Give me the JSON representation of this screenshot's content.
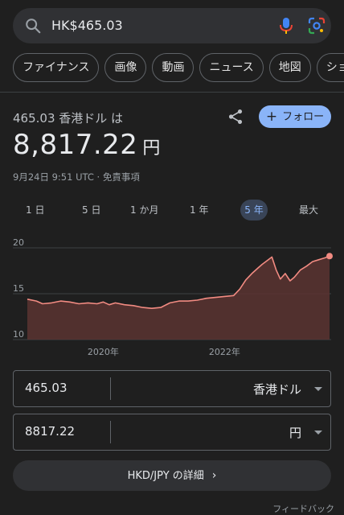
{
  "search": {
    "query": "HK$465.03"
  },
  "chips": [
    "ファイナンス",
    "画像",
    "動画",
    "ニュース",
    "地図",
    "ショ"
  ],
  "header": {
    "conversion_label": "465.03 香港ドル は",
    "follow_label": "フォロー",
    "value": "8,817.22",
    "unit": "円",
    "timestamp": "9月24日 9:51 UTC · 免責事項"
  },
  "ranges": [
    {
      "label": "1 日",
      "active": false
    },
    {
      "label": "5 日",
      "active": false
    },
    {
      "label": "1 か月",
      "active": false
    },
    {
      "label": "1 年",
      "active": false
    },
    {
      "label": "5 年",
      "active": true
    },
    {
      "label": "最大",
      "active": false
    }
  ],
  "chart_data": {
    "type": "area",
    "x_tick_labels": [
      "2020年",
      "2022年"
    ],
    "y_tick_labels": [
      "20",
      "15",
      "10"
    ],
    "ylim": [
      10,
      20
    ],
    "x_range": [
      2018.75,
      2023.73
    ],
    "series": [
      {
        "x": [
          2018.75,
          2018.9,
          2019.0,
          2019.15,
          2019.3,
          2019.45,
          2019.6,
          2019.75,
          2019.9,
          2020.0,
          2020.1,
          2020.2,
          2020.35,
          2020.5,
          2020.65,
          2020.8,
          2020.95,
          2021.1,
          2021.25,
          2021.4,
          2021.55,
          2021.7,
          2021.85,
          2022.0,
          2022.15,
          2022.25,
          2022.35,
          2022.45,
          2022.55,
          2022.62,
          2022.7,
          2022.78,
          2022.85,
          2022.92,
          2023.0,
          2023.08,
          2023.15,
          2023.25,
          2023.35,
          2023.45,
          2023.55,
          2023.65,
          2023.73
        ],
        "y": [
          14.4,
          14.2,
          13.9,
          14.0,
          14.2,
          14.1,
          13.9,
          14.0,
          13.9,
          14.1,
          13.8,
          14.0,
          13.8,
          13.7,
          13.5,
          13.4,
          13.5,
          14.0,
          14.2,
          14.2,
          14.3,
          14.5,
          14.6,
          14.7,
          14.8,
          15.5,
          16.5,
          17.2,
          17.8,
          18.2,
          18.6,
          19.0,
          17.6,
          16.6,
          17.2,
          16.4,
          16.8,
          17.6,
          18.0,
          18.5,
          18.7,
          18.9,
          19.1
        ]
      }
    ],
    "colors": {
      "line": "#f28b82",
      "fill": "#5b3431",
      "grid": "#3c4043"
    }
  },
  "converter": {
    "from_value": "465.03",
    "from_currency": "香港ドル",
    "to_value": "8817.22",
    "to_currency": "円"
  },
  "details_label": "HKD/JPY の詳細",
  "feedback_label": "フィードバック"
}
